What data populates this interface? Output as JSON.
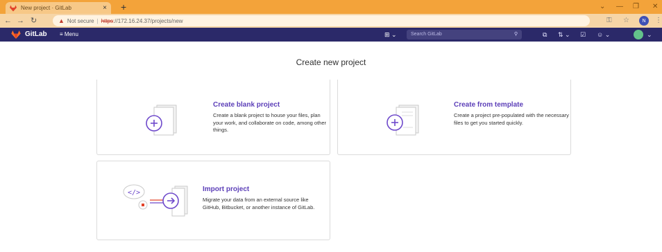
{
  "browser": {
    "tab_title": "New project · GitLab",
    "tab_close": "×",
    "new_tab": "+",
    "security_label": "Not secure",
    "url_scheme": "https",
    "url_rest": "://172.16.24.37/projects/new",
    "profile_initial": "N"
  },
  "gitlab_nav": {
    "brand": "GitLab",
    "menu_label": "≡ Menu",
    "search_placeholder": "Search GitLab"
  },
  "page": {
    "title": "Create new project"
  },
  "cards": [
    {
      "title": "Create blank project",
      "description": "Create a blank project to house your files, plan your work, and collaborate on code, among other things."
    },
    {
      "title": "Create from template",
      "description": "Create a project pre-populated with the necessary files to get you started quickly."
    },
    {
      "title": "Import project",
      "description": "Migrate your data from an external source like GitHub, Bitbucket, or another instance of GitLab."
    }
  ],
  "colors": {
    "tab_strip": "#f3a33a",
    "gitlab_nav": "#2b2969",
    "accent_purple": "#5c3fb8"
  }
}
